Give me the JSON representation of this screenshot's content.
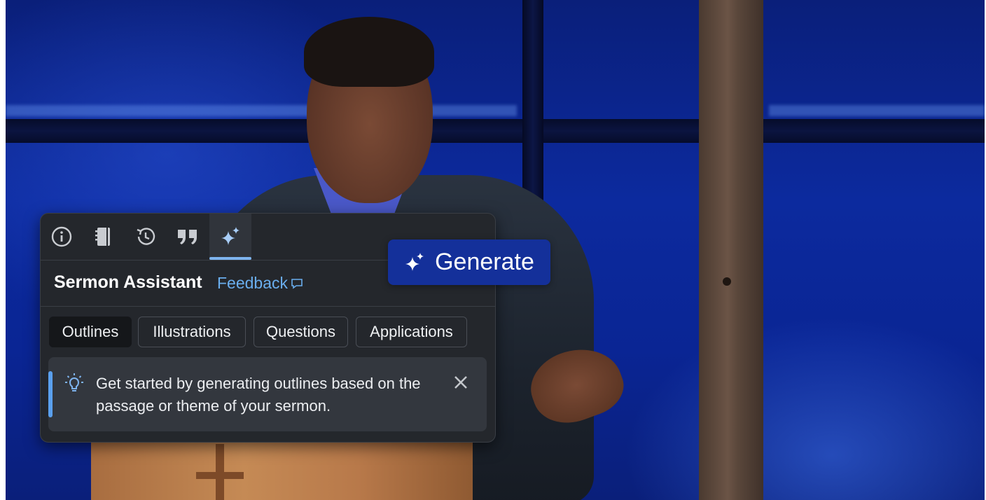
{
  "panel": {
    "title": "Sermon Assistant",
    "feedback_label": "Feedback",
    "toolbar_icons": [
      "info-icon",
      "notebook-icon",
      "history-icon",
      "quote-icon",
      "sparkle-icon"
    ],
    "active_tool": "sparkle-icon",
    "tabs": [
      {
        "label": "Outlines",
        "selected": true
      },
      {
        "label": "Illustrations",
        "selected": false
      },
      {
        "label": "Questions",
        "selected": false
      },
      {
        "label": "Applications",
        "selected": false
      }
    ],
    "tip": {
      "text": "Get started by generating outlines based on the passage or theme of your sermon."
    }
  },
  "generate_button": {
    "label": "Generate"
  },
  "colors": {
    "accent": "#7eb4ef",
    "link": "#6aaeee",
    "panel_bg": "#24272c",
    "generate_bg": "#14309a"
  }
}
